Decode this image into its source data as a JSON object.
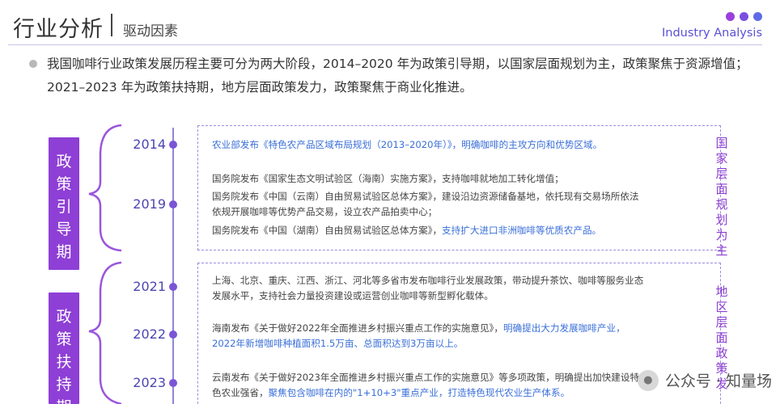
{
  "header": {
    "title": "行业分析",
    "subtitle": "驱动因素",
    "brand": "Industry Analysis",
    "dot_colors": [
      "#9b3fdc",
      "#7a4fe0",
      "#5f6ae6"
    ]
  },
  "summary": "我国咖啡行业政策发展历程主要可分为两大阶段，2014–2020 年为政策引导期，以国家层面规划为主，政策聚焦于资源增值；2021–2023 年为政策扶持期，地方层面政策发力，政策聚焦于商业化推进。",
  "phases": [
    {
      "label": [
        "政",
        "策",
        "引",
        "导",
        "期"
      ]
    },
    {
      "label": [
        "政",
        "策",
        "扶",
        "持",
        "期"
      ]
    }
  ],
  "years": [
    "2014",
    "2019",
    "2021",
    "2022",
    "2023"
  ],
  "levels": [
    {
      "label": [
        "国",
        "家",
        "层",
        "面",
        "规",
        "划",
        "为",
        "主"
      ]
    },
    {
      "label": [
        "地",
        "区",
        "层",
        "面",
        "政",
        "策",
        "发"
      ]
    }
  ],
  "entries": {
    "e2014": "农业部发布《特色农产品区域布局规划（2013–2020年）》，明确咖啡的主攻方向和优势区域。",
    "e2019a": "国务院发布《国家生态文明试验区（海南）实施方案》，支持咖啡就地加工转化增值；",
    "e2019b_l1": "国务院发布《中国（云南）自由贸易试验区总体方案》，建设沿边资源储备基地，依托现有交易场所依法",
    "e2019b_l2": "依规开展咖啡等优势产品交易，设立农产品拍卖中心；",
    "e2019c_plain": "国务院发布《中国（湖南）自由贸易试验区总体方案》，",
    "e2019c_hl": "支持扩大进口非洲咖啡等优质农产品。",
    "e2021_l1": "上海、北京、重庆、江西、浙江、河北等多省市发布咖啡行业发展政策，带动提升茶饮、咖啡等服务业态",
    "e2021_l2": "发展水平，支持社会力量投资建设或运营创业咖啡等新型孵化载体。",
    "e2022_plain": "海南发布《关于做好2022年全面推进乡村振兴重点工作的实施意见》，",
    "e2022_hl1": "明确提出大力发展咖啡产业，",
    "e2022_hl2": "2022年新增咖啡种植面积1.5万亩、总面积达到3万亩以上。",
    "e2023_l1": "云南发布《关于做好2023年全面推进乡村振兴重点工作的实施意见》等多项政策，明确提出加快建设特",
    "e2023_plain": "色农业强省，",
    "e2023_hl": "聚焦包含咖啡在内的\"1+10+3\"重点产业，打造特色现代农业生产体系。"
  },
  "watermark": {
    "icon": "wechat-icon",
    "text": "公众号 · 知量场"
  }
}
